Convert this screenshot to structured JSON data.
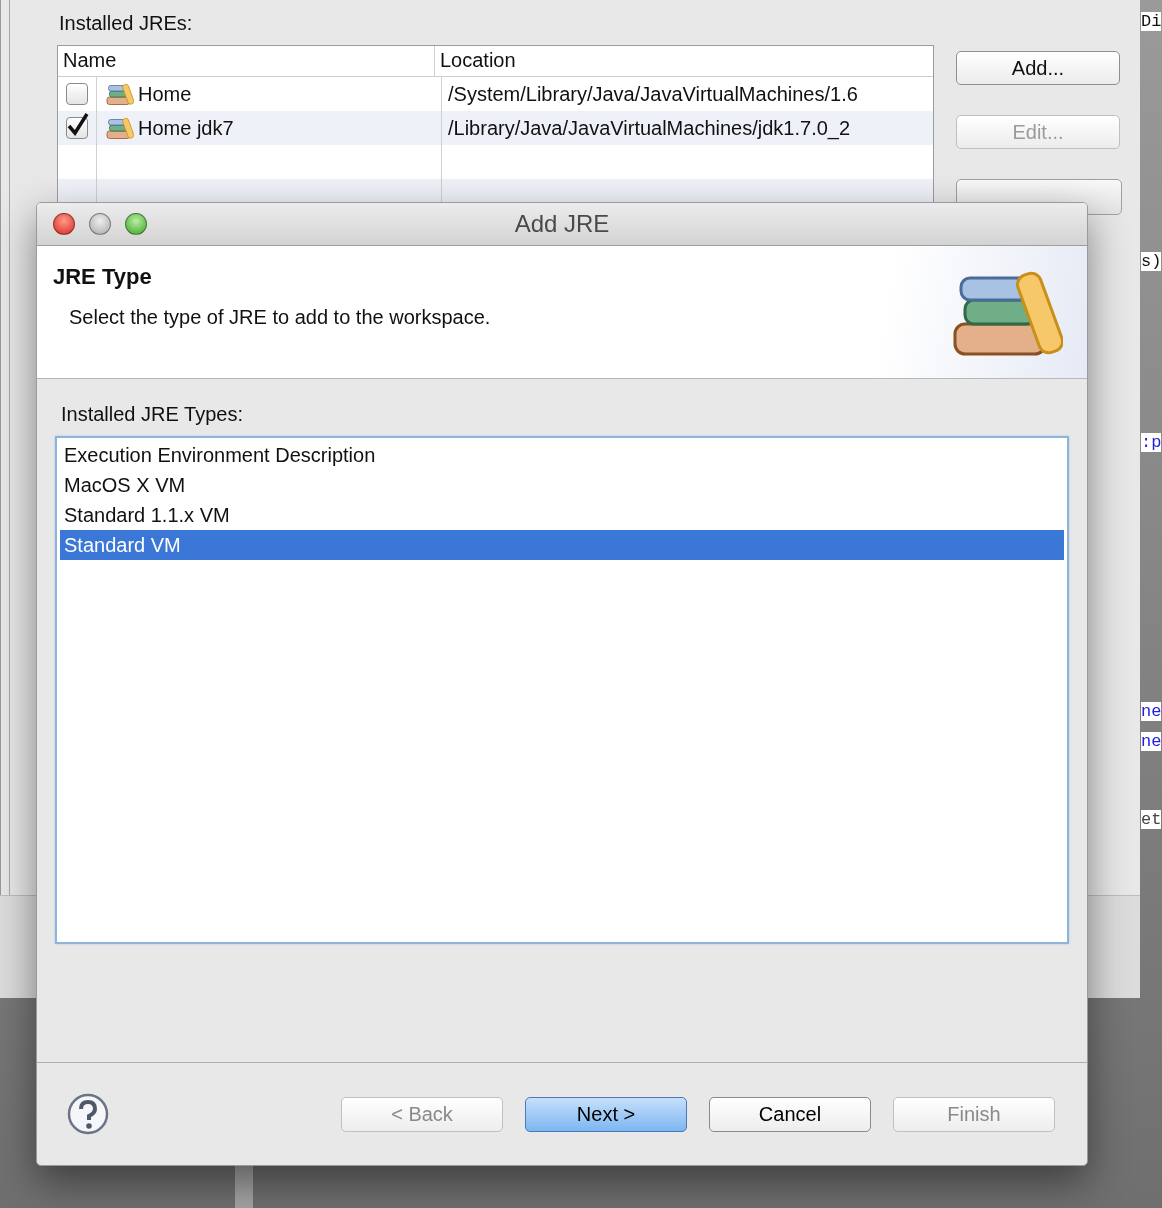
{
  "background_window": {
    "label": "Installed JREs:",
    "columns": [
      "Name",
      "Location"
    ],
    "rows": [
      {
        "name": "Home",
        "location": "/System/Library/Java/JavaVirtualMachines/1.6",
        "checked": false
      },
      {
        "name": "Home jdk7",
        "location": "/Library/Java/JavaVirtualMachines/jdk1.7.0_2",
        "checked": true
      }
    ],
    "buttons": [
      {
        "label": "Add...",
        "disabled": false
      },
      {
        "label": "Edit...",
        "disabled": true
      }
    ],
    "editor_fragments": [
      "Di",
      "s)",
      ":p",
      "ne",
      "ne",
      "et"
    ]
  },
  "dialog": {
    "title": "Add JRE",
    "header": {
      "title": "JRE Type",
      "description": "Select the type of JRE to add to the workspace."
    },
    "list_label": "Installed JRE Types:",
    "types": [
      {
        "label": "Execution Environment Description",
        "selected": false
      },
      {
        "label": "MacOS X VM",
        "selected": false
      },
      {
        "label": "Standard 1.1.x VM",
        "selected": false
      },
      {
        "label": "Standard VM",
        "selected": true
      }
    ],
    "buttons": [
      {
        "label": "< Back",
        "disabled": true,
        "default": false
      },
      {
        "label": "Next >",
        "disabled": false,
        "default": true
      },
      {
        "label": "Cancel",
        "disabled": false,
        "default": false
      },
      {
        "label": "Finish",
        "disabled": true,
        "default": false
      }
    ]
  }
}
